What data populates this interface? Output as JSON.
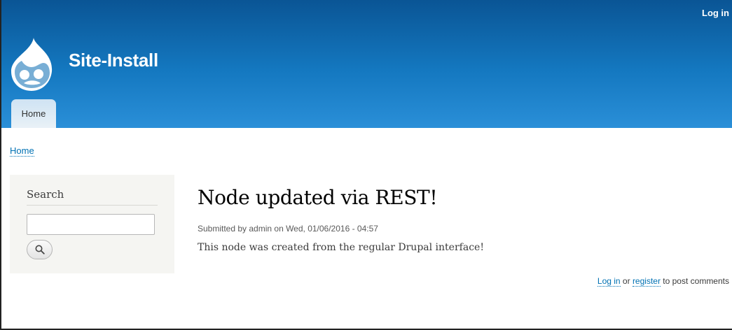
{
  "header": {
    "login_link": "Log in",
    "site_name": "Site-Install",
    "logo_icon": "drupal-drop-logo-icon",
    "gradient_top": "#0a5595",
    "gradient_bottom": "#2a8fd8",
    "tabs": [
      {
        "label": "Home",
        "active": true
      }
    ]
  },
  "breadcrumb": {
    "items": [
      "Home"
    ]
  },
  "sidebar": {
    "search": {
      "title": "Search",
      "input_value": "",
      "button_icon": "search-icon"
    }
  },
  "node": {
    "title": "Node updated via REST!",
    "submitted": "Submitted by admin on Wed, 01/06/2016 - 04:57",
    "body": "This node was created from the regular Drupal interface!"
  },
  "comments": {
    "login_label": "Log in",
    "or_text": " or ",
    "register_label": "register",
    "suffix_text": " to post comments"
  },
  "colors": {
    "link": "#0071b3",
    "sidebar_bg": "#f5f5f2"
  }
}
